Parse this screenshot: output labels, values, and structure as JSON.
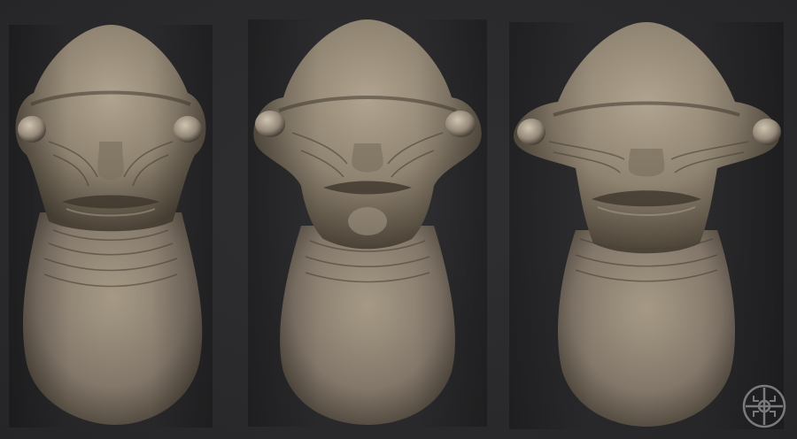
{
  "scene": {
    "background_color": "#2b2b2d",
    "clay_base_color": "#8e8270",
    "clay_highlight_color": "#b0a490",
    "clay_shadow_color": "#4a4236"
  },
  "sculpts": [
    {
      "view": "front-left"
    },
    {
      "view": "front"
    },
    {
      "view": "front-right"
    }
  ],
  "logo": {
    "icon": "studio-logo-icon",
    "color": "#7a7a7c"
  }
}
